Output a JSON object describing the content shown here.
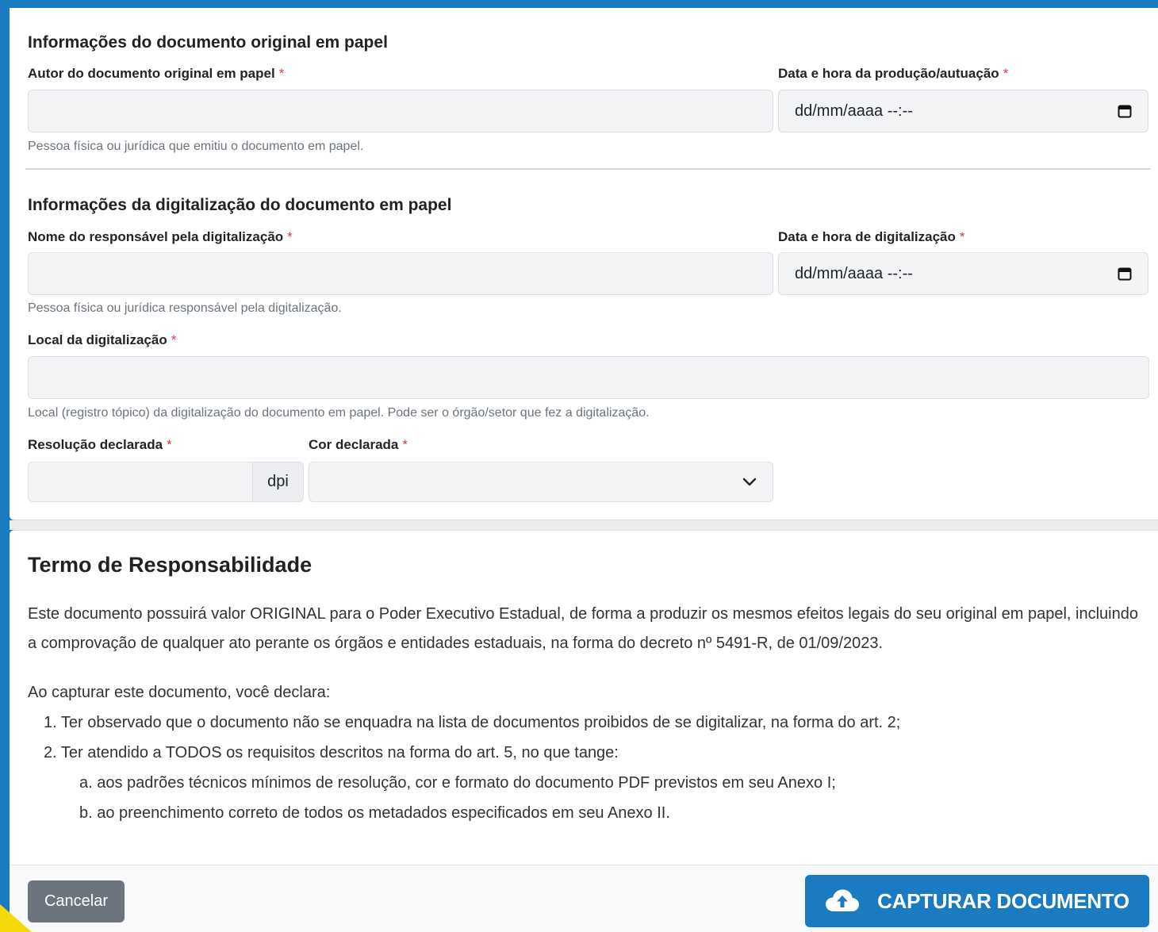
{
  "original": {
    "section_title": "Informações do documento original em papel",
    "author_label": "Autor do documento original em papel",
    "author_value": "",
    "author_help": "Pessoa física ou jurídica que emitiu o documento em papel.",
    "date_label": "Data e hora da produção/autuação",
    "date_placeholder": "dd/mm/aaaa --:--"
  },
  "digitization": {
    "section_title": "Informações da digitalização do documento em papel",
    "responsible_label": "Nome do responsável pela digitalização",
    "responsible_value": "",
    "responsible_help": "Pessoa física ou jurídica responsável pela digitalização.",
    "date_label": "Data e hora de digitalização",
    "date_placeholder": "dd/mm/aaaa --:--",
    "place_label": "Local da digitalização",
    "place_value": "",
    "place_help": "Local (registro tópico) da digitalização do documento em papel. Pode ser o órgão/setor que fez a digitalização.",
    "resolution_label": "Resolução declarada",
    "resolution_value": "",
    "resolution_unit": "dpi",
    "color_label": "Cor declarada",
    "color_value": ""
  },
  "required_marker": "*",
  "term": {
    "title": "Termo de Responsabilidade",
    "paragraph": "Este documento possuirá valor ORIGINAL para o Poder Executivo Estadual, de forma a produzir os mesmos efeitos legais do seu original em papel, incluindo a comprovação de qualquer ato perante os órgãos e entidades estaduais, na forma do decreto nº 5491-R, de 01/09/2023.",
    "intro": "Ao capturar este documento, você declara:",
    "items": [
      "1. Ter observado que o documento não se enquadra na lista de documentos proibidos de se digitalizar, na forma do art. 2;",
      "2. Ter atendido a TODOS os requisitos descritos na forma do art. 5, no que tange:"
    ],
    "subitems": [
      "a. aos padrões técnicos mínimos de resolução, cor e formato do documento PDF previstos em seu Anexo I;",
      "b. ao preenchimento correto de todos os metadados especificados em seu Anexo II."
    ]
  },
  "footer": {
    "cancel_label": "Cancelar",
    "capture_label": "CAPTURAR DOCUMENTO"
  },
  "icons": {
    "calendar": "calendar-icon",
    "chevron": "chevron-down-icon",
    "upload": "cloud-upload-icon"
  },
  "colors": {
    "primary": "#1a7bc0",
    "secondary": "#6c757d",
    "required": "#dc3545"
  }
}
